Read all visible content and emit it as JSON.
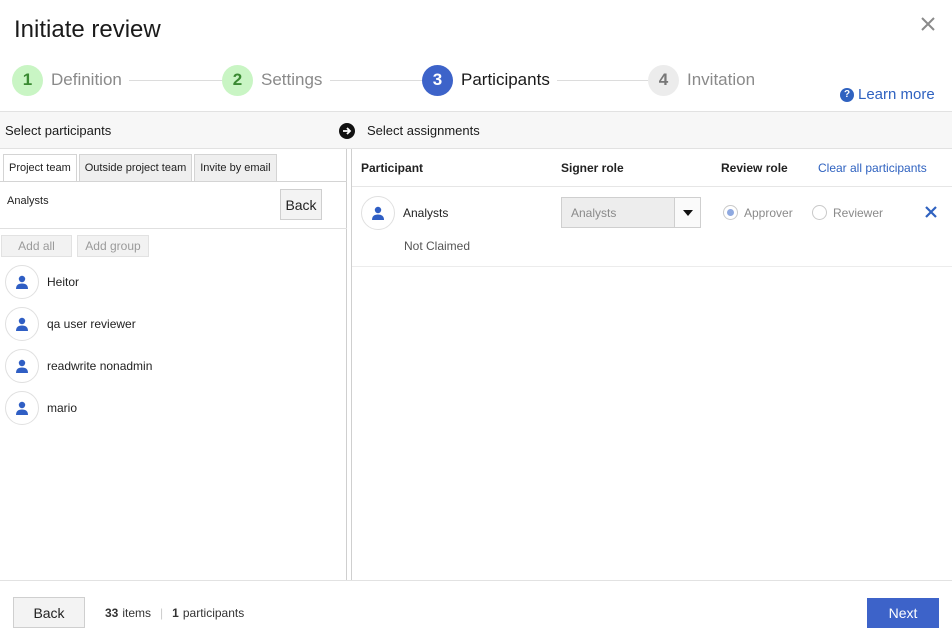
{
  "dialog": {
    "title": "Initiate review"
  },
  "steps": [
    {
      "num": "1",
      "label": "Definition"
    },
    {
      "num": "2",
      "label": "Settings"
    },
    {
      "num": "3",
      "label": "Participants"
    },
    {
      "num": "4",
      "label": "Invitation"
    }
  ],
  "learn_more": "Learn more",
  "bar": {
    "left": "Select participants",
    "right": "Select assignments"
  },
  "left": {
    "tabs": [
      "Project team",
      "Outside project team",
      "Invite by email"
    ],
    "breadcrumb": "Analysts",
    "back_label": "Back",
    "add_all": "Add all",
    "add_group": "Add group",
    "people": [
      "Heitor",
      "qa user reviewer",
      "readwrite nonadmin",
      "mario"
    ]
  },
  "right": {
    "headers": {
      "participant": "Participant",
      "signer_role": "Signer role",
      "review_role": "Review role",
      "clear_all": "Clear all participants"
    },
    "rows": [
      {
        "name": "Analysts",
        "status": "Not Claimed",
        "signer_role": "Analysts",
        "approver": "Approver",
        "reviewer": "Reviewer",
        "selected_role": "Approver"
      }
    ]
  },
  "footer": {
    "back": "Back",
    "items_count": "33",
    "items_label": "items",
    "participants_count": "1",
    "participants_label": "participants",
    "next": "Next"
  },
  "colors": {
    "primary": "#3d63c9",
    "link": "#2f62c0",
    "done": "#c9f5c4"
  }
}
